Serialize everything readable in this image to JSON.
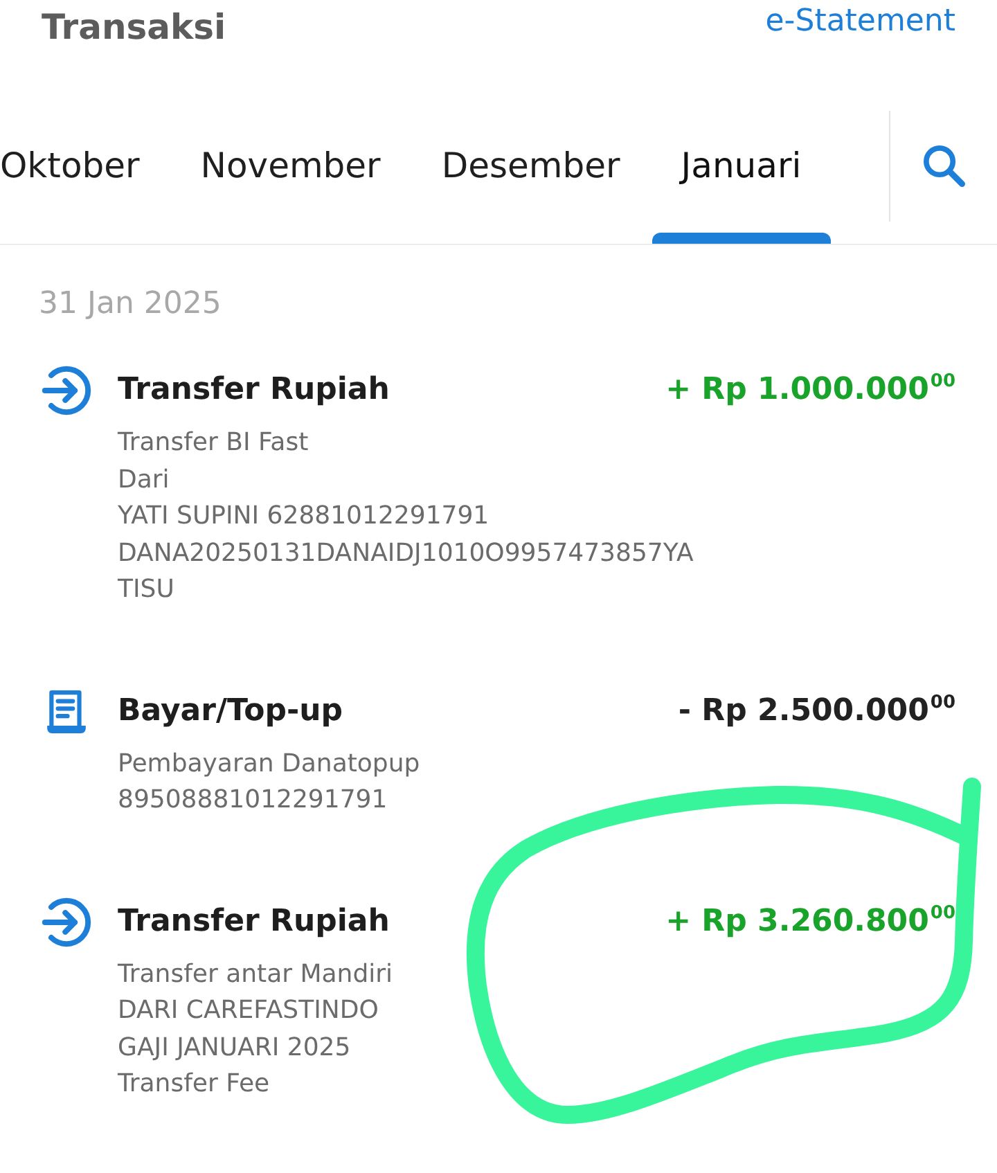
{
  "header": {
    "title": "Transaksi",
    "link": "e-Statement"
  },
  "tabs": [
    {
      "label": "Oktober",
      "selected": false
    },
    {
      "label": "November",
      "selected": false
    },
    {
      "label": "Desember",
      "selected": false
    },
    {
      "label": "Januari",
      "selected": true
    }
  ],
  "date_groups": [
    {
      "date": "31 Jan 2025",
      "transactions": [
        {
          "kind": "transfer",
          "title": "Transfer Rupiah",
          "credit": true,
          "amount": "+ Rp 1.000.000$^{00}$",
          "details": [
            "Transfer BI Fast",
            "Dari",
            "YATI SUPINI 62881012291791",
            "DANA20250131DANAIDJ1010O9957473857YA",
            "TISU"
          ]
        },
        {
          "kind": "payment",
          "title": "Bayar/Top-up",
          "credit": false,
          "amount": "- Rp 2.500.000$^{00}$",
          "details": [
            "Pembayaran Danatopup",
            "89508881012291791"
          ]
        },
        {
          "kind": "transfer",
          "title": "Transfer Rupiah",
          "credit": true,
          "amount": "+ Rp 3.260.800$^{00}$",
          "details": [
            "Transfer antar Mandiri",
            "DARI CAREFASTINDO",
            "GAJI JANUARI 2025",
            "Transfer Fee"
          ]
        }
      ]
    }
  ]
}
